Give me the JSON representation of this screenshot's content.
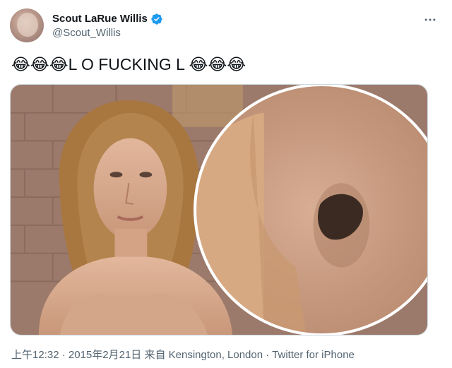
{
  "author": {
    "display_name": "Scout LaRue Willis",
    "handle": "@Scout_Willis",
    "avatar_icon": "profile-avatar",
    "verified_icon": "verified-badge-icon",
    "verified_color": "#1d9bf0"
  },
  "more_icon": "more-options-icon",
  "tweet": {
    "text": "😂😂😂L O FUCKING L 😂😂😂"
  },
  "media": {
    "image_icon": "photo-collage"
  },
  "meta": {
    "time": "上午12:32",
    "sep1": " · ",
    "date": "2015年2月21日",
    "location_prefix": " 来自 ",
    "location": "Kensington, London",
    "sep2": " · ",
    "client": "Twitter for iPhone"
  },
  "colors": {
    "text_primary": "#0f1419",
    "text_secondary": "#536471",
    "border": "#cfd9de",
    "accent": "#1d9bf0"
  }
}
